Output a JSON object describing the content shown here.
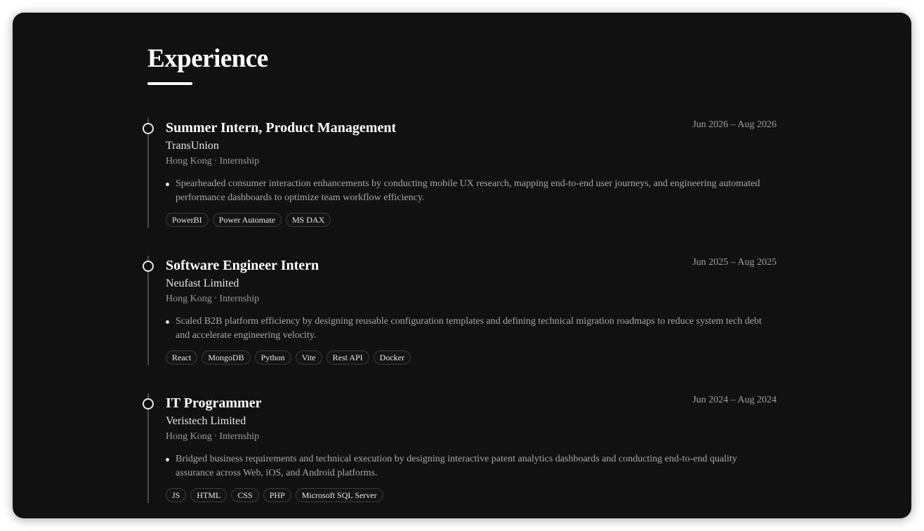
{
  "section": {
    "title": "Experience"
  },
  "experience": [
    {
      "role": "Summer Intern, Product Management",
      "date": "Jun 2026 – Aug 2026",
      "company": "TransUnion",
      "location": "Hong Kong",
      "type": "Internship",
      "bullet": "Spearheaded consumer interaction enhancements by conducting mobile UX research, mapping end-to-end user journeys, and engineering automated performance dashboards to optimize team workflow efficiency.",
      "tags": [
        "PowerBI",
        "Power Automate",
        "MS DAX"
      ]
    },
    {
      "role": "Software Engineer Intern",
      "date": "Jun 2025 – Aug 2025",
      "company": "Neufast Limited",
      "location": "Hong Kong",
      "type": "Internship",
      "bullet": "Scaled B2B platform efficiency by designing reusable configuration templates and defining technical migration roadmaps to reduce system tech debt and accelerate engineering velocity.",
      "tags": [
        "React",
        "MongoDB",
        "Python",
        "Vite",
        "Rest API",
        "Docker"
      ]
    },
    {
      "role": "IT Programmer",
      "date": "Jun 2024 – Aug 2024",
      "company": "Veristech Limited",
      "location": "Hong Kong",
      "type": "Internship",
      "bullet": "Bridged business requirements and technical execution by designing interactive patent analytics dashboards and conducting end-to-end quality assurance across Web, iOS, and Android platforms.",
      "tags": [
        "JS",
        "HTML",
        "CSS",
        "PHP",
        "Microsoft SQL Server"
      ]
    }
  ]
}
